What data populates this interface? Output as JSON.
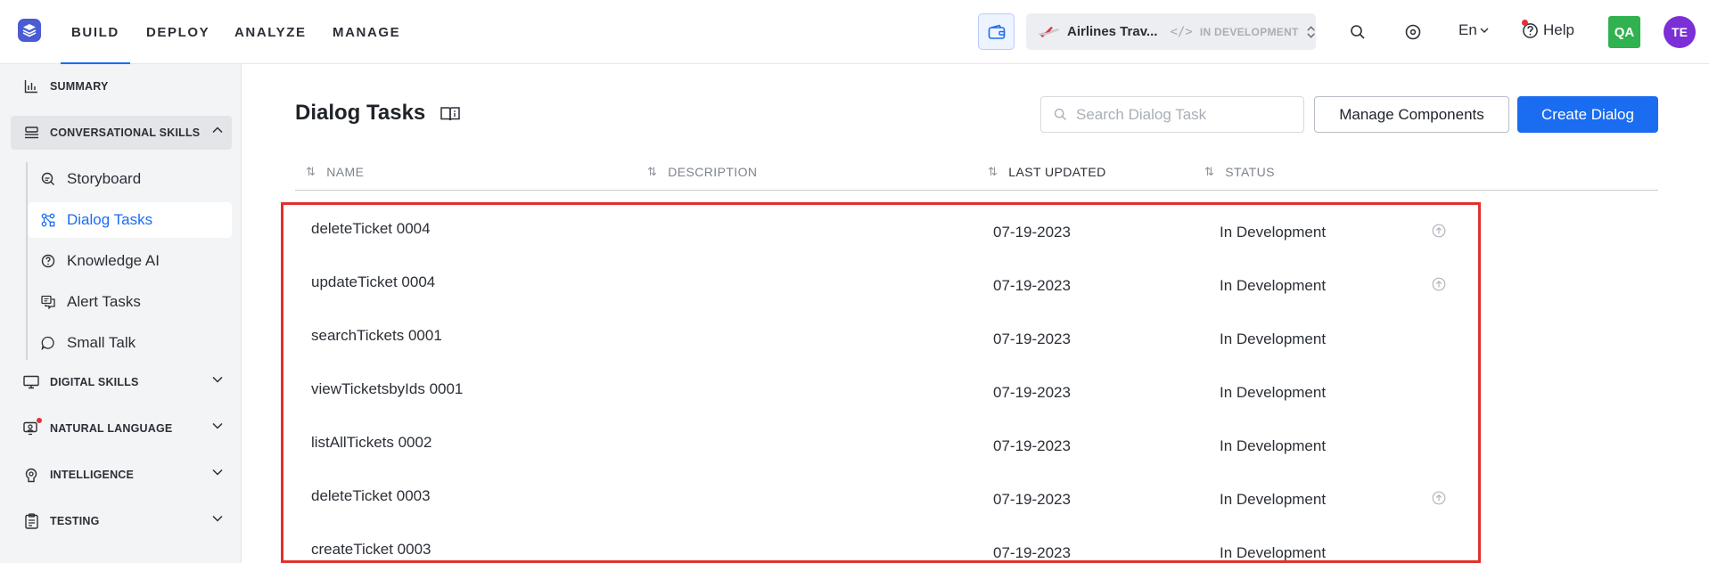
{
  "topbar": {
    "nav": [
      {
        "label": "BUILD",
        "active": true
      },
      {
        "label": "DEPLOY",
        "active": false
      },
      {
        "label": "ANALYZE",
        "active": false
      },
      {
        "label": "MANAGE",
        "active": false
      }
    ],
    "app_name": "Airlines Trav...",
    "app_env": "IN DEVELOPMENT",
    "lang": "En",
    "help": "Help",
    "qa_badge": "QA",
    "user_initials": "TE",
    "accent": "#1a6cf0"
  },
  "sidebar": {
    "summary": "SUMMARY",
    "conversational": "CONVERSATIONAL SKILLS",
    "items": [
      "Storyboard",
      "Dialog Tasks",
      "Knowledge AI",
      "Alert Tasks",
      "Small Talk"
    ],
    "active_item": "Dialog Tasks",
    "sections": [
      "DIGITAL SKILLS",
      "NATURAL LANGUAGE",
      "INTELLIGENCE",
      "TESTING"
    ]
  },
  "main": {
    "title": "Dialog Tasks",
    "search_placeholder": "Search Dialog Task",
    "manage_btn": "Manage Components",
    "create_btn": "Create Dialog",
    "columns": [
      "NAME",
      "DESCRIPTION",
      "LAST UPDATED",
      "STATUS"
    ],
    "rows": [
      {
        "name": "deleteTicket 0004",
        "updated": "07-19-2023",
        "status": "In Development",
        "publish_icon": true
      },
      {
        "name": "updateTicket 0004",
        "updated": "07-19-2023",
        "status": "In Development",
        "publish_icon": true
      },
      {
        "name": "searchTickets 0001",
        "updated": "07-19-2023",
        "status": "In Development",
        "publish_icon": false
      },
      {
        "name": "viewTicketsbyIds 0001",
        "updated": "07-19-2023",
        "status": "In Development",
        "publish_icon": false
      },
      {
        "name": "listAllTickets 0002",
        "updated": "07-19-2023",
        "status": "In Development",
        "publish_icon": false
      },
      {
        "name": "deleteTicket 0003",
        "updated": "07-19-2023",
        "status": "In Development",
        "publish_icon": true
      },
      {
        "name": "createTicket 0003",
        "updated": "07-19-2023",
        "status": "In Development",
        "publish_icon": false
      }
    ]
  }
}
